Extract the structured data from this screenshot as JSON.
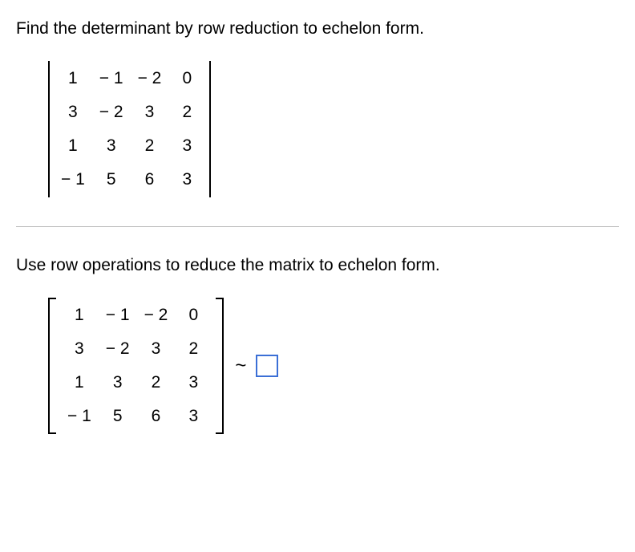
{
  "problem": {
    "statement": "Find the determinant by row reduction to echelon form."
  },
  "matrix1": {
    "r1c1": "1",
    "r1c2": "− 1",
    "r1c3": "− 2",
    "r1c4": "0",
    "r2c1": "3",
    "r2c2": "− 2",
    "r2c3": "3",
    "r2c4": "2",
    "r3c1": "1",
    "r3c2": "3",
    "r3c3": "2",
    "r3c4": "3",
    "r4c1": "− 1",
    "r4c2": "5",
    "r4c3": "6",
    "r4c4": "3"
  },
  "instruction": "Use row operations to reduce the matrix to echelon form.",
  "matrix2": {
    "r1c1": "1",
    "r1c2": "− 1",
    "r1c3": "− 2",
    "r1c4": "0",
    "r2c1": "3",
    "r2c2": "− 2",
    "r2c3": "3",
    "r2c4": "2",
    "r3c1": "1",
    "r3c2": "3",
    "r3c3": "2",
    "r3c4": "3",
    "r4c1": "− 1",
    "r4c2": "5",
    "r4c3": "6",
    "r4c4": "3"
  },
  "tilde": "~"
}
